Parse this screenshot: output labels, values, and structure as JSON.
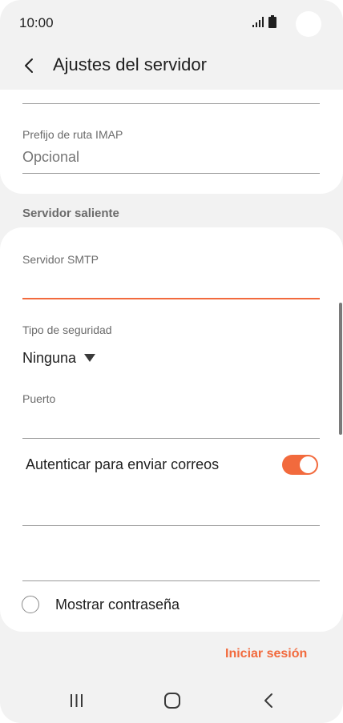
{
  "status_bar": {
    "time": "10:00"
  },
  "header": {
    "title": "Ajustes del servidor"
  },
  "imap": {
    "path_prefix_label": "Prefijo de ruta IMAP",
    "path_prefix_placeholder": "Opcional"
  },
  "outgoing": {
    "section_title": "Servidor saliente",
    "smtp_server_label": "Servidor SMTP",
    "smtp_server_value": "",
    "security_type_label": "Tipo de seguridad",
    "security_type_value": "Ninguna",
    "port_label": "Puerto",
    "port_value": "",
    "auth_label": "Autenticar para enviar correos",
    "auth_enabled": true,
    "username_value": "",
    "password_value": "",
    "show_password_label": "Mostrar contraseña",
    "show_password_checked": false
  },
  "actions": {
    "login_label": "Iniciar sesión"
  },
  "colors": {
    "accent": "#f26a3d",
    "background": "#f2f2f2",
    "card": "#ffffff"
  },
  "icons": {
    "back": "chevron-left-icon",
    "dropdown": "triangle-down-icon",
    "signal": "signal-icon",
    "battery": "battery-icon",
    "nav_recents": "recents-icon",
    "nav_home": "home-icon",
    "nav_back": "back-icon"
  }
}
